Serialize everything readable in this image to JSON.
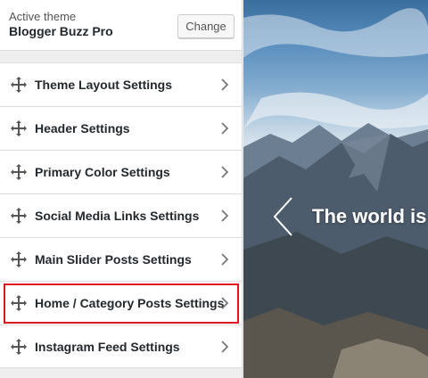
{
  "theme": {
    "label": "Active theme",
    "name": "Blogger Buzz Pro",
    "change_button": "Change"
  },
  "sections": [
    {
      "label": "Theme Layout Settings",
      "icon": "move-icon"
    },
    {
      "label": "Header Settings",
      "icon": "move-icon"
    },
    {
      "label": "Primary Color Settings",
      "icon": "move-icon"
    },
    {
      "label": "Social Media Links Settings",
      "icon": "move-icon"
    },
    {
      "label": "Main Slider Posts Settings",
      "icon": "move-icon"
    },
    {
      "label": "Home / Category Posts Settings",
      "icon": "move-icon",
      "highlighted": true
    },
    {
      "label": "Instagram Feed Settings",
      "icon": "move-icon"
    }
  ],
  "preview": {
    "hero_text": "The world is"
  },
  "colors": {
    "highlight": "#e0161e",
    "text": "#23282d"
  }
}
